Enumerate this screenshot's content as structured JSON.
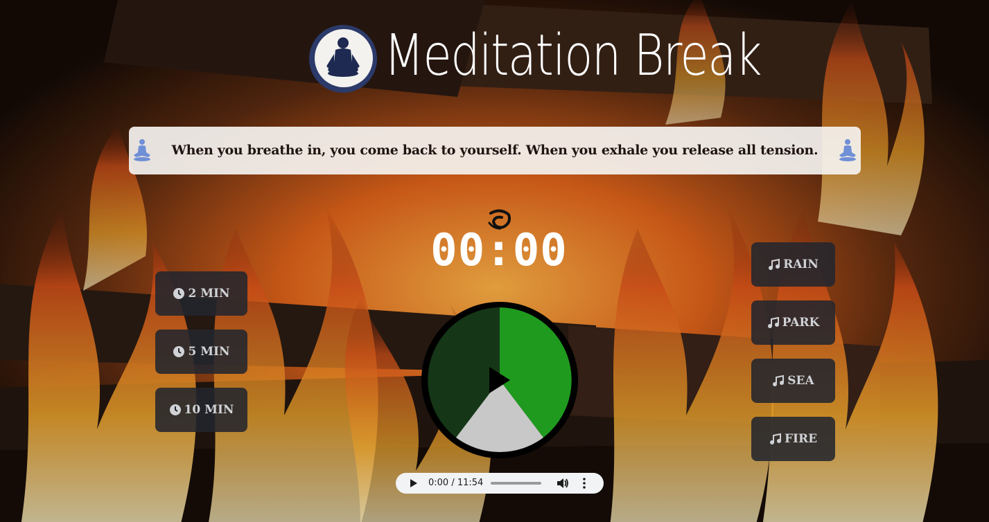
{
  "app": {
    "title": "Meditation Break"
  },
  "quote": {
    "text": "When you breathe in, you come back to yourself. When you exhale you release all tension."
  },
  "timer": {
    "display": "00:00"
  },
  "durations": [
    {
      "label": "2 MIN",
      "icon": "clock-icon"
    },
    {
      "label": "5 MIN",
      "icon": "clock-icon"
    },
    {
      "label": "10 MIN",
      "icon": "clock-icon"
    }
  ],
  "sounds": [
    {
      "label": "RAIN",
      "icon": "music-note-icon"
    },
    {
      "label": "PARK",
      "icon": "music-note-icon"
    },
    {
      "label": "SEA",
      "icon": "music-note-icon"
    },
    {
      "label": "FIRE",
      "icon": "music-note-icon"
    }
  ],
  "audio_player": {
    "time": "0:00 / 11:54",
    "progress": 0
  },
  "colors": {
    "pie_green": "#1f9a1f",
    "pie_dark": "#163a18",
    "pie_gray": "#c8c8c8",
    "button_bg": "#23262d",
    "emblem_blue": "#2c3a6a"
  }
}
